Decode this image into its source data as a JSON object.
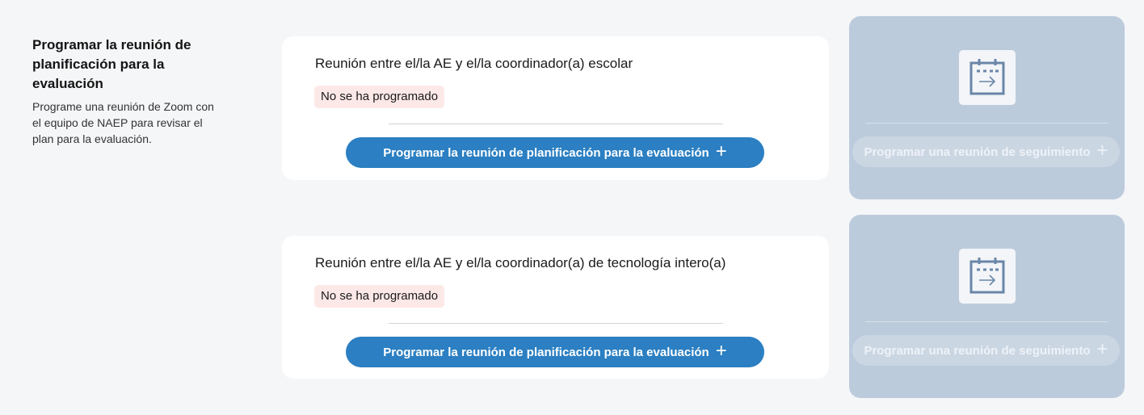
{
  "section": {
    "title": "Programar la reunión de planificación para la evaluación",
    "description": "Programe una reunión de Zoom con el equipo de NAEP para revisar el plan para la evaluación."
  },
  "meetings": [
    {
      "title": "Reunión entre el/la AE y el/la coordinador(a) escolar",
      "status": "No se ha programado",
      "button_label": "Programar la reunión de planificación para la evaluación",
      "followup_label": "Programar una reunión de seguimiento"
    },
    {
      "title": "Reunión entre el/la AE y el/la coordinador(a) de tecnología intero(a)",
      "status": "No se ha programado",
      "button_label": "Programar la reunión de planificación para la evaluación",
      "followup_label": "Programar una reunión de seguimiento"
    }
  ],
  "icons": {
    "plus": "plus-icon",
    "calendar": "calendar-arrow-icon"
  },
  "colors": {
    "primary_button": "#2b7fc2",
    "status_badge_bg": "#fde8e8",
    "side_panel_bg": "#bccbdc",
    "page_bg": "#f5f6f8"
  }
}
